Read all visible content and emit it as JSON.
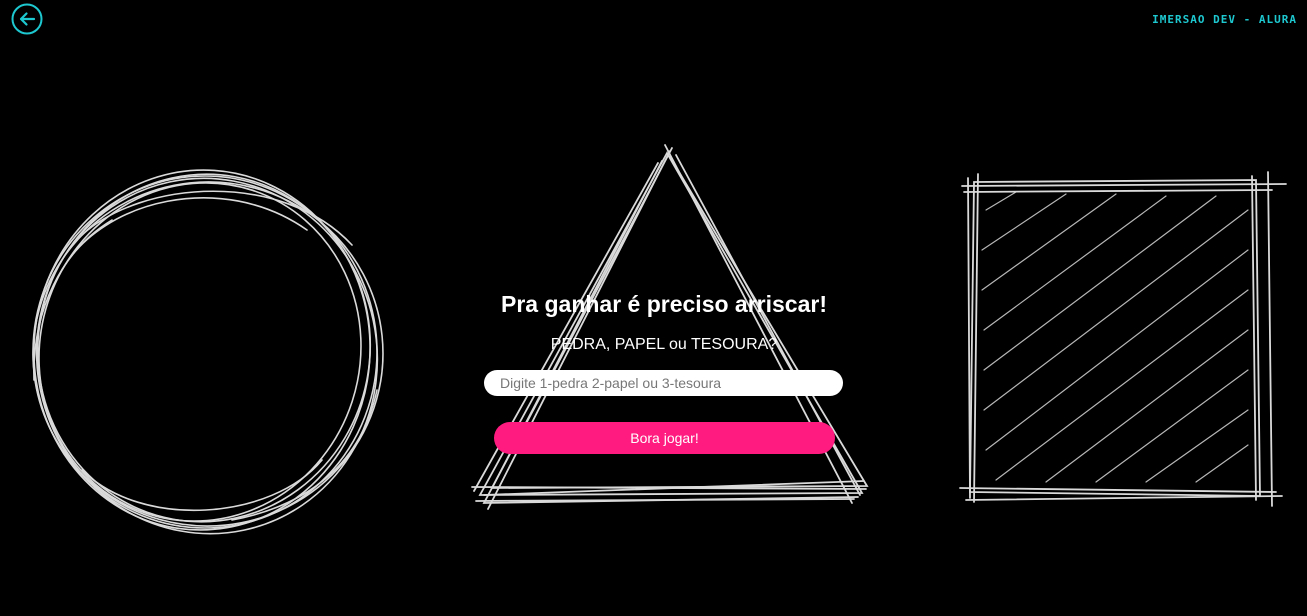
{
  "header": {
    "back_icon": "arrow-left-circle-icon",
    "brand_text": "IMERSAO DEV - ALURA",
    "accent_color": "#1ec8d0"
  },
  "background": {
    "shapes": [
      "circle",
      "triangle",
      "square"
    ],
    "color": "#000000",
    "stroke_color": "#e6e6e6"
  },
  "game": {
    "headline": "Pra ganhar é preciso arriscar!",
    "subline": "PEDRA, PAPEL ou TESOURA?",
    "input_value": "",
    "input_placeholder": "Digite 1-pedra 2-papel ou 3-tesoura",
    "play_button": "Bora jogar!",
    "button_color": "#ff1b7f"
  }
}
